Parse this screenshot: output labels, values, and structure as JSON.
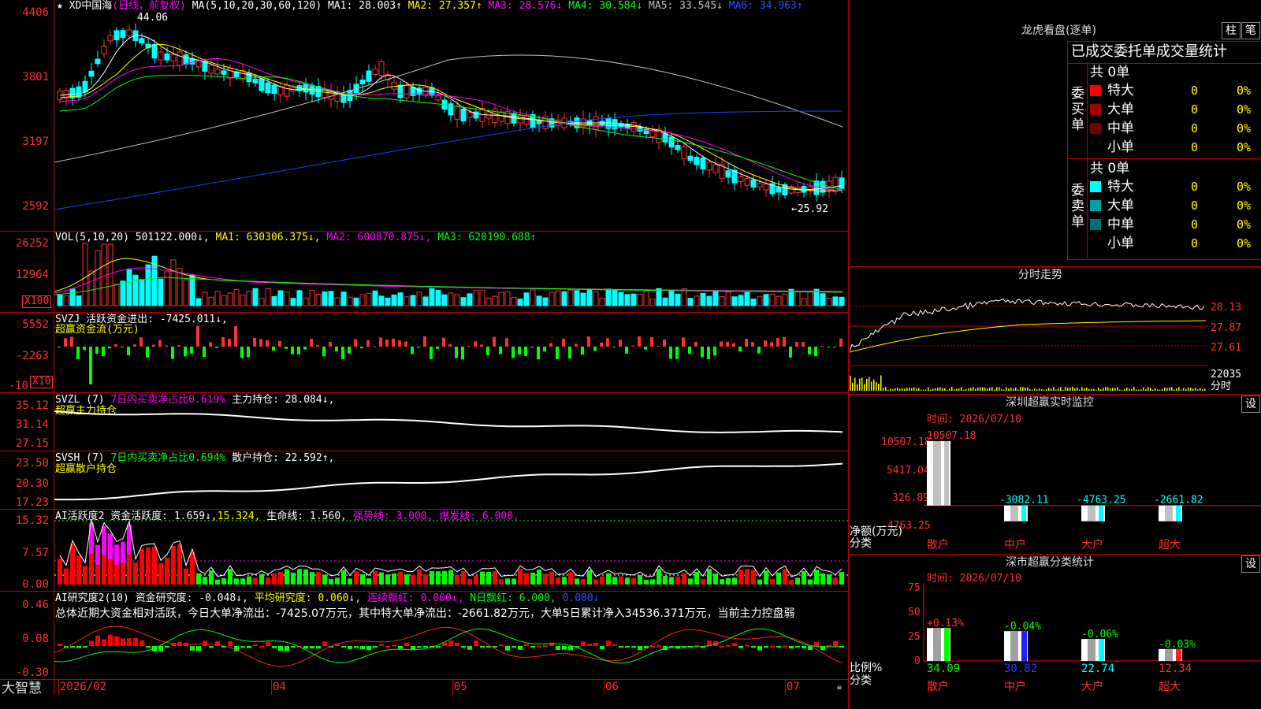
{
  "main_chart": {
    "title": "XD中国海",
    "period": "(日线，前复权)",
    "ma_prefix": "MA(5,10,20,30,60,120)",
    "ma": [
      {
        "label": "MA1: 28.003↑",
        "color": "#ffffff"
      },
      {
        "label": "MA2: 27.357↑",
        "color": "#ffff00"
      },
      {
        "label": "MA3: 28.576↓",
        "color": "#ff00ff"
      },
      {
        "label": "MA4: 30.584↓",
        "color": "#00ff00"
      },
      {
        "label": "MA5: 33.545↓",
        "color": "#c0c0c0"
      },
      {
        "label": "MA6: 34.963↑",
        "color": "#2040ff"
      }
    ],
    "high_label": "44.06",
    "low_label": "←25.92",
    "y_ticks": [
      "4406",
      "3801",
      "3197",
      "2592"
    ]
  },
  "vol_panel": {
    "title": "VOL(5,10,20)",
    "value": "501122.000↓,",
    "ma1": "MA1: 630306.375↓,",
    "ma2": "MA2: 600870.875↓,",
    "ma3": "MA3: 620190.688↑",
    "y_ticks": [
      "26252",
      "12964"
    ],
    "unit": "X100"
  },
  "svzj_panel": {
    "title": "SVZJ  活跃资金进出: -7425.011↓,",
    "subtitle": "超赢资金流(万元)",
    "y_ticks": [
      "5552",
      "-2263",
      "-10"
    ],
    "unit": "X10"
  },
  "svzl_panel": {
    "title": "SVZL (7)",
    "ratio": "7日内买卖净占比0.619%",
    "hold": "主力持仓: 28.084↓,",
    "subtitle": "超赢主力持仓",
    "y_ticks": [
      "35.12",
      "31.14",
      "27.15"
    ]
  },
  "svsh_panel": {
    "title": "SVSH (7)",
    "ratio": "7日内买卖净占比0.694%",
    "hold": "散户持仓: 22.592↑,",
    "subtitle": "超赢散户持仓",
    "y_ticks": [
      "23.50",
      "20.30",
      "17.23"
    ]
  },
  "ai_active_panel": {
    "title": "AI活跃度2 资金活跃度: 1.659↓,",
    "v2": "15.324,",
    "life": "生命线: 1.560,",
    "strong": "强势线: 3.000,",
    "burst": "爆发线: 6.000,",
    "y_ticks": [
      "15.32",
      "7.57",
      "0.00"
    ]
  },
  "ai_research_panel": {
    "title": "AI研究度2(10) 资金研究度: -0.048↓,",
    "avg": "平均研究度: 0.060↓,",
    "red": "连续飘红: 0.000↓,",
    "nred": "N日飘红: 6.000,",
    "v5": "0.000↓",
    "summary": "总体近期大资金相对活跃，今日大单净流出：-7425.07万元，其中特大单净流出：-2661.82万元，大单5日累计净入34536.371万元，当前主力控盘弱",
    "y_ticks": [
      "0.46",
      "0.08",
      "-0.30"
    ]
  },
  "x_axis": {
    "labels": [
      "2026/02",
      "04",
      "05",
      "06",
      "07"
    ]
  },
  "brand": "大智慧",
  "right_panel": {
    "dragon_title": "龙虎看盘(逐单)",
    "btn_bar": "柱",
    "btn_pen": "笔",
    "table_title": "已成交委托单成交量统计",
    "buy_label": "委买单",
    "sell_label": "委卖单",
    "buy_total": "共 0单",
    "sell_total": "共 0单",
    "buy_rows": [
      {
        "name": "特大",
        "count": "0",
        "pct": "0%",
        "color": "#ff0000"
      },
      {
        "name": "大单",
        "count": "0",
        "pct": "0%",
        "color": "#a00000"
      },
      {
        "name": "中单",
        "count": "0",
        "pct": "0%",
        "color": "#700000"
      },
      {
        "name": "小单",
        "count": "0",
        "pct": "0%",
        "color": "#000000"
      }
    ],
    "sell_rows": [
      {
        "name": "特大",
        "count": "0",
        "pct": "0%",
        "color": "#00ffff"
      },
      {
        "name": "大单",
        "count": "0",
        "pct": "0%",
        "color": "#00a0a0"
      },
      {
        "name": "中单",
        "count": "0",
        "pct": "0%",
        "color": "#007070"
      },
      {
        "name": "小单",
        "count": "0",
        "pct": "0%",
        "color": "#000000"
      }
    ],
    "intraday_title": "分时走势",
    "intraday_ticks": [
      "28.13",
      "27.87",
      "27.61",
      "22035"
    ],
    "intraday_unit": "分时",
    "monitor_title": "深圳超赢实时监控",
    "monitor_btn": "设",
    "monitor_time": "时间: 2026/07/10",
    "monitor_ticks": [
      "10507.18",
      "5417.04",
      "326.89",
      "-4763.25"
    ],
    "monitor_unit": "净额(万元)",
    "monitor_cat": "分类",
    "monitor_bars": [
      {
        "name": "散户",
        "value": "10507.18"
      },
      {
        "name": "中户",
        "value": "-3082.11"
      },
      {
        "name": "大户",
        "value": "-4763.25"
      },
      {
        "name": "超大",
        "value": "-2661.82"
      }
    ],
    "stat_title": "深市超赢分类统计",
    "stat_btn": "设",
    "stat_time": "时间: 2026/07/10",
    "stat_ticks": [
      "75",
      "50",
      "25",
      "0"
    ],
    "stat_unit": "比例%",
    "stat_cat": "分类",
    "stat_bars": [
      {
        "name": "散户",
        "value": "34.09",
        "delta": "+0.13%"
      },
      {
        "name": "中户",
        "value": "30.82",
        "delta": "-0.04%"
      },
      {
        "name": "大户",
        "value": "22.74",
        "delta": "-0.06%"
      },
      {
        "name": "超大",
        "value": "12.34",
        "delta": "-0.03%"
      }
    ]
  },
  "chart_data": [
    {
      "type": "bar",
      "title": "深圳超赢实时监控",
      "ylabel": "净额(万元)",
      "categories": [
        "散户",
        "中户",
        "大户",
        "超大"
      ],
      "values": [
        10507.18,
        -3082.11,
        -4763.25,
        -2661.82
      ],
      "ylim": [
        -4763.25,
        10507.18
      ]
    },
    {
      "type": "bar",
      "title": "深市超赢分类统计",
      "ylabel": "比例%",
      "categories": [
        "散户",
        "中户",
        "大户",
        "超大"
      ],
      "values": [
        34.09,
        30.82,
        22.74,
        12.34
      ],
      "ylim": [
        0,
        75
      ]
    }
  ]
}
